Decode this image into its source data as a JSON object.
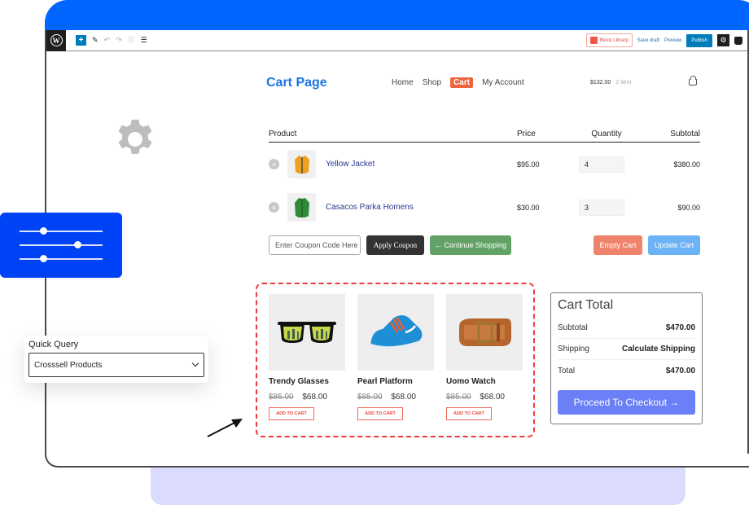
{
  "editor_toolbar": {
    "logo": "wordpress-logo",
    "left_icons": [
      "add-block-icon",
      "edit-pencil-icon",
      "undo-icon",
      "redo-icon",
      "info-icon",
      "list-view-icon"
    ],
    "block_library_label": "Block Library",
    "save_draft_label": "Save draft",
    "preview_label": "Preview",
    "publish_label": "Publish",
    "right_icons": [
      "settings-gear-icon",
      "bag-icon",
      "more-options-icon"
    ]
  },
  "site": {
    "title": "Cart Page",
    "nav": [
      {
        "label": "Home",
        "active": false
      },
      {
        "label": "Shop",
        "active": false
      },
      {
        "label": "Cart",
        "active": true
      },
      {
        "label": "My Account",
        "active": false
      }
    ],
    "mini_cart": {
      "amount": "$132.00",
      "count": "2 item"
    }
  },
  "cart_table": {
    "headers": {
      "product": "Product",
      "price": "Price",
      "quantity": "Quantity",
      "subtotal": "Subtotal"
    },
    "rows": [
      {
        "name": "Yellow Jacket",
        "price": "$95.00",
        "quantity": "4",
        "subtotal": "$380.00",
        "thumb_color": "#f0a020"
      },
      {
        "name": "Casacos Parka Homens",
        "price": "$30.00",
        "quantity": "3",
        "subtotal": "$90.00",
        "thumb_color": "#2e8b3a"
      }
    ]
  },
  "actions": {
    "coupon_placeholder": "Enter Coupon Code Here",
    "apply_coupon": "Apply Coupon",
    "continue_shopping": "← Continue Shopping",
    "empty_cart": "Empty Cart",
    "update_cart": "Update Cart"
  },
  "crosssell": {
    "products": [
      {
        "name": "Trendy Glasses",
        "old_price": "$85.00",
        "price": "$68.00",
        "button": "ADD TO CART",
        "image": "sunglasses"
      },
      {
        "name": "Pearl Platform",
        "old_price": "$85.00",
        "price": "$68.00",
        "button": "ADD TO CART",
        "image": "sneaker"
      },
      {
        "name": "Uomo Watch",
        "old_price": "$85.00",
        "price": "$68.00",
        "button": "ADD TO CART",
        "image": "belt"
      }
    ]
  },
  "cart_total": {
    "title": "Cart Total",
    "rows": [
      {
        "label": "Subtotal",
        "value": "$470.00"
      },
      {
        "label": "Shipping",
        "value": "Calculate Shipping"
      },
      {
        "label": "Total",
        "value": "$470.00"
      }
    ],
    "checkout": "Proceed To Checkout →"
  },
  "quick_query": {
    "label": "Quick Query",
    "selected": "Crosssell Products"
  },
  "colors": {
    "header_blue": "#0066ff",
    "slider_blue": "#0042f5",
    "accent_orange": "#f0643c",
    "dashed_red": "#ee3a3a",
    "checkout_purple": "#6b7ff7",
    "lavender": "#dadbfe"
  }
}
